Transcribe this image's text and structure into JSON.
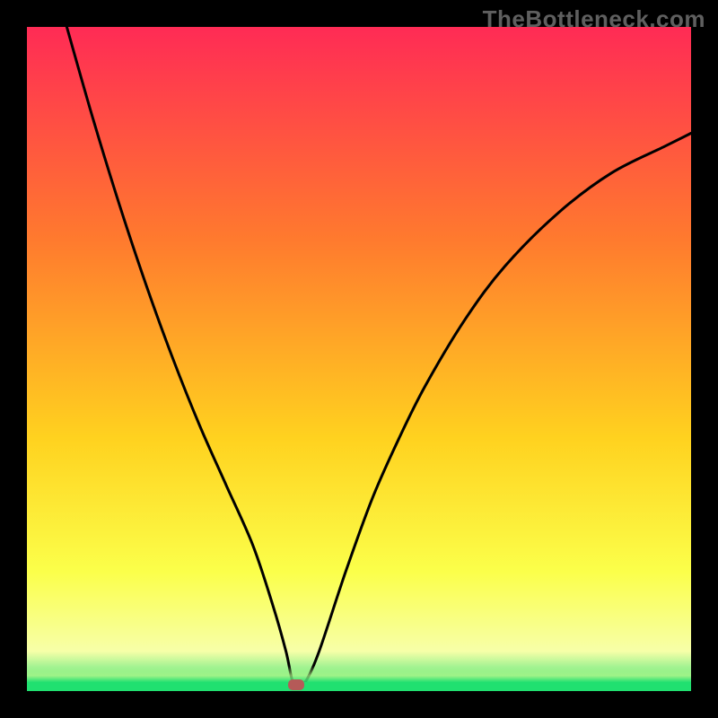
{
  "watermark": "TheBottleneck.com",
  "colors": {
    "frame": "#000000",
    "watermark": "#5f5f5f",
    "curve": "#000000",
    "green": "#20e070",
    "marker": "#b55a58",
    "grad_top": "#ff2b55",
    "grad_mid1": "#ff7a2e",
    "grad_mid2": "#ffd21f",
    "grad_mid3": "#fbff4a",
    "grad_low": "#f7ffa8"
  },
  "chart_data": {
    "type": "line",
    "title": "",
    "xlabel": "",
    "ylabel": "",
    "xlim": [
      0,
      100
    ],
    "ylim": [
      0,
      100
    ],
    "grid": false,
    "legend": false,
    "marker": {
      "x": 40.5,
      "y": 1
    },
    "series": [
      {
        "name": "bottleneck-curve",
        "x": [
          6,
          10,
          14,
          18,
          22,
          26,
          30,
          34,
          37,
          39,
          40,
          41,
          42,
          44,
          48,
          52,
          56,
          60,
          66,
          72,
          80,
          88,
          96,
          100
        ],
        "values": [
          100,
          86,
          73,
          61,
          50,
          40,
          31,
          22,
          13,
          6,
          1.5,
          1.2,
          1.5,
          6,
          18,
          29,
          38,
          46,
          56,
          64,
          72,
          78,
          82,
          84
        ]
      }
    ]
  }
}
